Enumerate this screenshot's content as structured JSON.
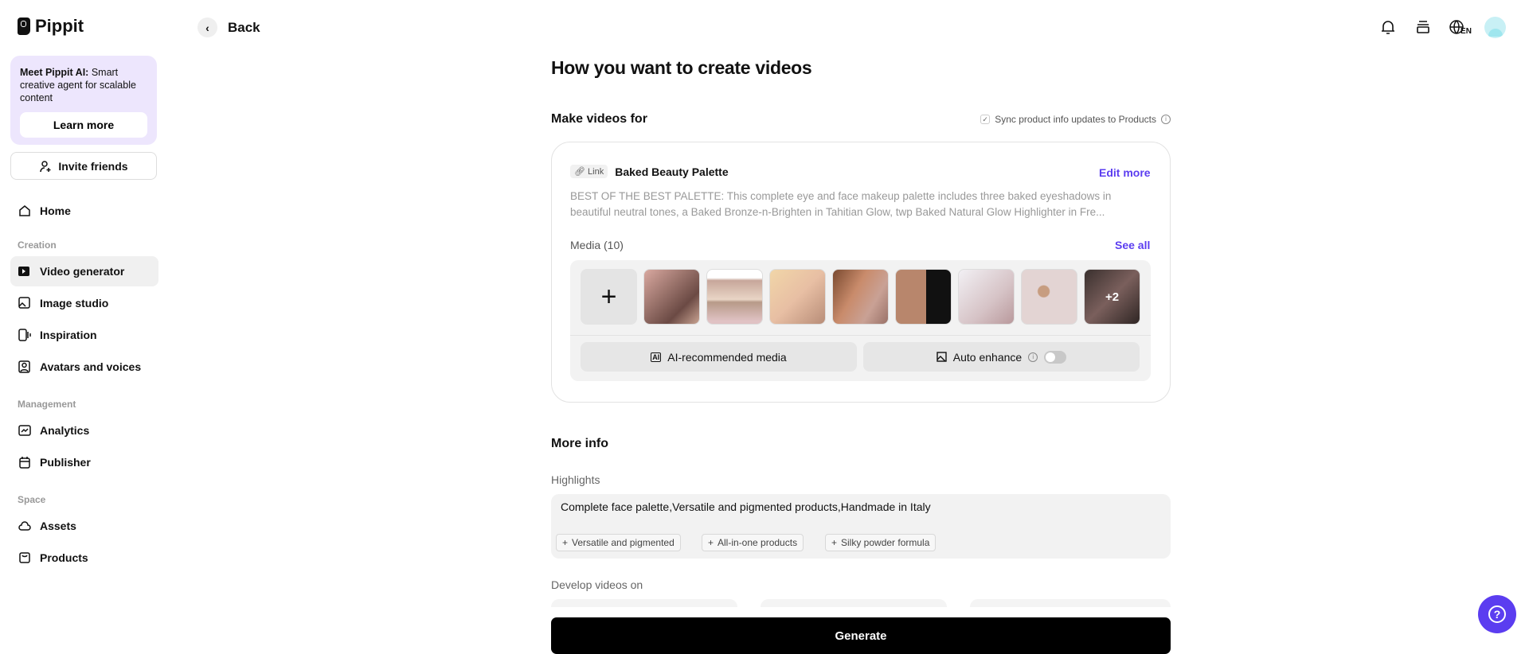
{
  "app": {
    "name": "Pippit"
  },
  "sidebar": {
    "promo": {
      "title": "Meet Pippit AI:",
      "text": " Smart creative agent for scalable content",
      "button": "Learn more"
    },
    "invite": "Invite friends",
    "home": "Home",
    "sections": [
      {
        "label": "Creation",
        "items": [
          {
            "label": "Video generator",
            "icon": "video-generator-icon",
            "active": true
          },
          {
            "label": "Image studio",
            "icon": "image-studio-icon"
          },
          {
            "label": "Inspiration",
            "icon": "inspiration-icon"
          },
          {
            "label": "Avatars and voices",
            "icon": "avatar-icon"
          }
        ]
      },
      {
        "label": "Management",
        "items": [
          {
            "label": "Analytics",
            "icon": "analytics-icon"
          },
          {
            "label": "Publisher",
            "icon": "calendar-icon"
          }
        ]
      },
      {
        "label": "Space",
        "items": [
          {
            "label": "Assets",
            "icon": "cloud-icon"
          },
          {
            "label": "Products",
            "icon": "box-icon"
          }
        ]
      }
    ]
  },
  "header": {
    "back": "Back",
    "lang": "EN"
  },
  "main": {
    "title": "How you want to create videos",
    "make_videos_for": "Make videos for",
    "sync_label": "Sync product info updates to Products",
    "sync_checked": true,
    "product": {
      "badge": "Link",
      "name": "Baked Beauty Palette",
      "edit": "Edit more",
      "description": "BEST OF THE BEST PALETTE: This complete eye and face makeup palette includes three baked eyeshadows in beautiful neutral tones, a Baked Bronze-n-Brighten in Tahitian Glow, twp Baked Natural Glow Highlighter in Fre..."
    },
    "media": {
      "label": "Media (10)",
      "see_all": "See all",
      "more_count": "+2",
      "ai_button": "AI-recommended media",
      "auto_enhance": "Auto enhance",
      "auto_enhance_on": false
    },
    "more_info": "More info",
    "highlights_label": "Highlights",
    "highlights_value": "Complete face palette,Versatile and pigmented products,Handmade in Italy",
    "tags": [
      "Versatile and pigmented",
      "All-in-one products",
      "Silky powder formula"
    ],
    "develop_label": "Develop videos on",
    "generate": "Generate"
  },
  "colors": {
    "accent": "#5b3df0",
    "promo_bg": "#ede6fd"
  }
}
